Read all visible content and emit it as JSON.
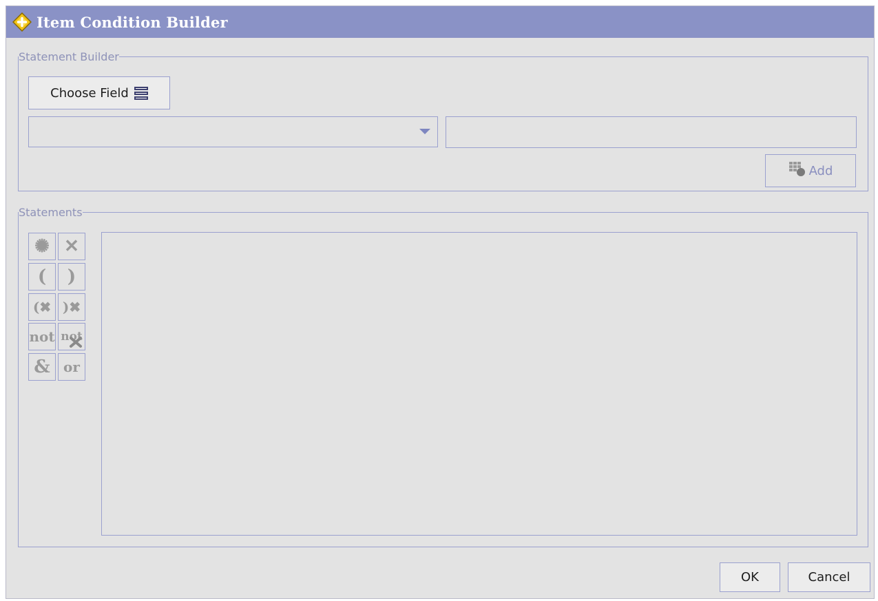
{
  "window": {
    "title": "Item Condition Builder",
    "title_icon": "diamond-icon"
  },
  "statement_builder": {
    "legend": "Statement Builder",
    "choose_field_label": "Choose Field",
    "choose_field_icon": "list-icon",
    "operator_select_value": "",
    "value_field_value": "",
    "add_label": "Add",
    "add_icon": "grid-add-icon",
    "add_enabled": false
  },
  "statements": {
    "legend": "Statements",
    "tools": [
      {
        "name": "clear-all",
        "glyph": "✺",
        "icon": "clear-icon"
      },
      {
        "name": "delete",
        "glyph": "✕",
        "icon": "delete-icon"
      },
      {
        "name": "open-paren",
        "glyph": "(",
        "icon": "open-paren-icon"
      },
      {
        "name": "close-paren",
        "glyph": ")",
        "icon": "close-paren-icon"
      },
      {
        "name": "remove-open-paren",
        "glyph": "(✖",
        "icon": "remove-open-paren-icon"
      },
      {
        "name": "remove-close-paren",
        "glyph": ")✖",
        "icon": "remove-close-paren-icon"
      },
      {
        "name": "not",
        "glyph": "not",
        "icon": "not-icon"
      },
      {
        "name": "remove-not",
        "glyph": "not",
        "icon": "remove-not-icon"
      },
      {
        "name": "and",
        "glyph": "&",
        "icon": "and-icon"
      },
      {
        "name": "or",
        "glyph": "or",
        "icon": "or-icon"
      }
    ],
    "items": []
  },
  "footer": {
    "ok_label": "OK",
    "cancel_label": "Cancel"
  },
  "colors": {
    "titlebar": "#8a92c6",
    "background": "#e3e3e3",
    "border": "#9aa0cf",
    "disabled_text": "#8a8fbf"
  }
}
